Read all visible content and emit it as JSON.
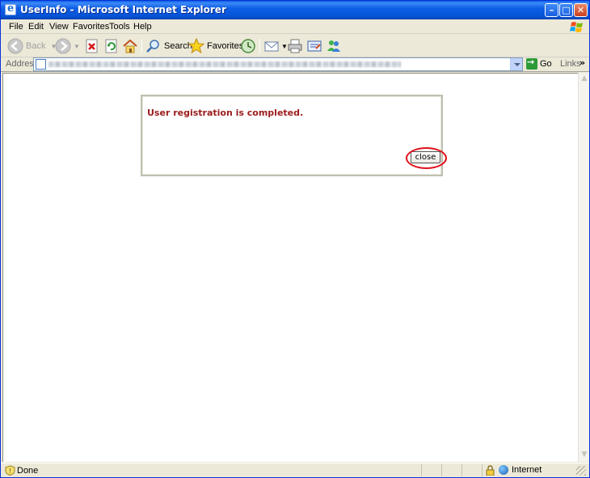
{
  "window": {
    "title": "UserInfo - Microsoft Internet Explorer",
    "minimize_glyph": "–",
    "maximize_glyph": "□",
    "close_glyph": "✕"
  },
  "menubar": {
    "items": [
      "File",
      "Edit",
      "View",
      "Favorites",
      "Tools",
      "Help"
    ]
  },
  "toolbar": {
    "back_label": "Back",
    "search_label": "Search",
    "favorites_label": "Favorites"
  },
  "addressbar": {
    "label": "Address",
    "go_label": "Go",
    "links_label": "Links",
    "links_chevron": "»"
  },
  "page": {
    "message": "User registration is completed.",
    "close_button_label": "close"
  },
  "statusbar": {
    "status_text": "Done",
    "zone_text": "Internet"
  },
  "colors": {
    "message_color": "#9b1b1b",
    "highlight_color": "#e0101a",
    "titlebar_blue": "#0553d4"
  }
}
